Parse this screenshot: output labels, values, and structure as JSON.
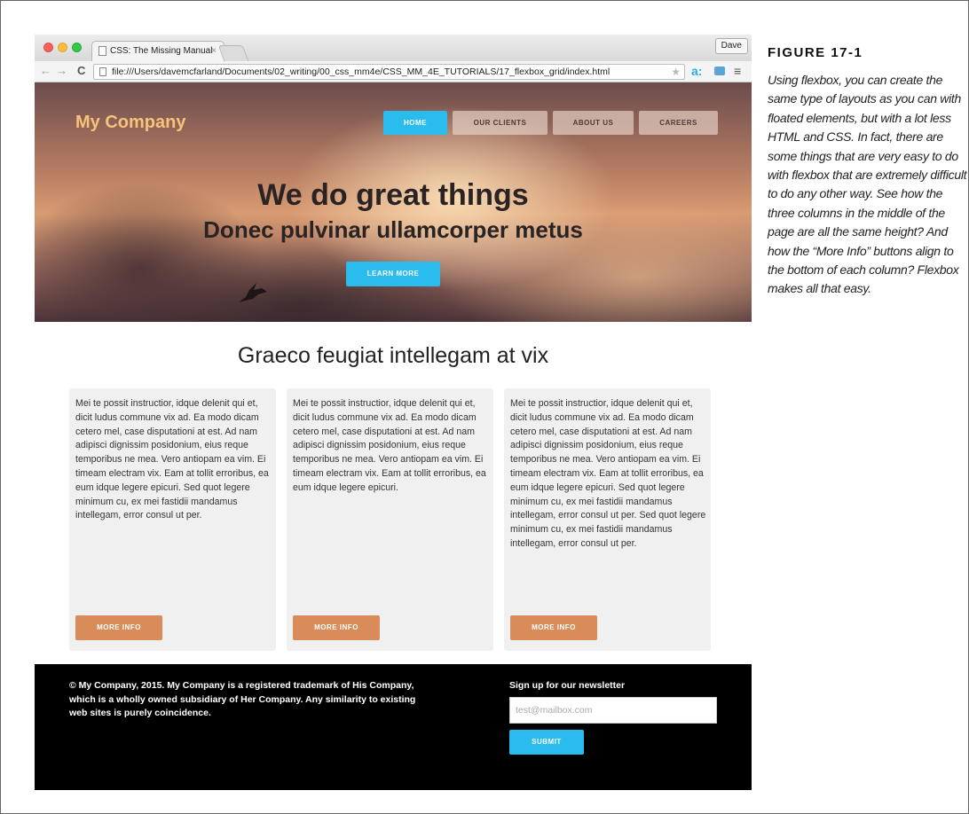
{
  "browser": {
    "tab_title": "CSS: The Missing Manual",
    "tab_close": "×",
    "profile_label": "Dave",
    "url": "file:///Users/davemcfarland/Documents/02_writing/00_css_mm4e/CSS_MM_4E_TUTORIALS/17_flexbox_grid/index.html",
    "icons": {
      "back": "←",
      "forward": "→",
      "reload": "C",
      "star": "★",
      "ext": "a:",
      "menu": "≡"
    }
  },
  "site": {
    "logo": "My Company",
    "nav": [
      {
        "label": "HOME",
        "active": true
      },
      {
        "label": "OUR CLIENTS",
        "active": false
      },
      {
        "label": "ABOUT US",
        "active": false
      },
      {
        "label": "CAREERS",
        "active": false
      }
    ],
    "hero": {
      "title": "We do great things",
      "subtitle": "Donec pulvinar ullamcorper metus",
      "cta": "LEARN MORE"
    },
    "section_title": "Graeco feugiat intellegam at vix",
    "columns": [
      {
        "text": "Mei te possit instructior, idque delenit qui et, dicit ludus commune vix ad. Ea modo dicam cetero mel, case disputationi at est. Ad nam adipisci dignissim posidonium, eius reque temporibus ne mea. Vero antiopam ea vim. Ei timeam electram vix. Eam at tollit erroribus, ea eum idque legere epicuri. Sed quot legere minimum cu, ex mei fastidii mandamus intellegam, error consul ut per.",
        "button": "MORE INFO"
      },
      {
        "text": "Mei te possit instructior, idque delenit qui et, dicit ludus commune vix ad. Ea modo dicam cetero mel, case disputationi at est. Ad nam adipisci dignissim posidonium, eius reque temporibus ne mea. Vero antiopam ea vim. Ei timeam electram vix. Eam at tollit erroribus, ea eum idque legere epicuri.",
        "button": "MORE INFO"
      },
      {
        "text": "Mei te possit instructior, idque delenit qui et, dicit ludus commune vix ad. Ea modo dicam cetero mel, case disputationi at est. Ad nam adipisci dignissim posidonium, eius reque temporibus ne mea. Vero antiopam ea vim. Ei timeam electram vix. Eam at tollit erroribus, ea eum idque legere epicuri. Sed quot legere minimum cu, ex mei fastidii mandamus intellegam, error consul ut per. Sed quot legere minimum cu, ex mei fastidii mandamus intellegam, error consul ut per.",
        "button": "MORE INFO"
      }
    ],
    "footer": {
      "legal": "© My Company, 2015. My Company is a registered trademark of His Company, which is a wholly owned subsidiary of Her Company. Any similarity to existing web sites is purely coincidence.",
      "newsletter_heading": "Sign up for our newsletter",
      "email_placeholder": "test@mailbox.com",
      "submit_label": "SUBMIT"
    }
  },
  "caption": {
    "figure_label": "FIGURE 17-1",
    "text": "Using flexbox, you can create the same type of layouts as you can with floated elements, but with a lot less HTML and CSS. In fact, there are some things that are very easy to do with flexbox that are extremely difficult to do any other way. See how the three columns in the middle of the page are all the same height? And how the “More Info” buttons align to the bottom of each column? Flexbox makes all that easy."
  },
  "colors": {
    "accent_blue": "#29bced",
    "button_orange": "#d98c5a",
    "logo_gold": "#f6c27c",
    "footer_bg": "#000000"
  }
}
